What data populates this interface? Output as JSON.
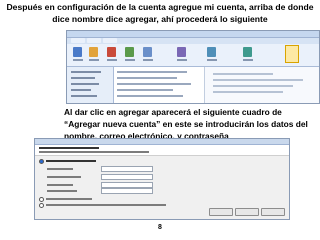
{
  "slide": {
    "top_caption": "Después en configuración de la cuenta agregue mi cuenta, arriba de donde dice nombre dice agregar, ahí procederá lo siguiente",
    "mid_caption": "Al dar clic en agregar aparecerá el siguiente cuadro de “Agregar nueva cuenta” en este se introducirán los datos del nombre, correo electrónico, y contraseña",
    "page_number": "8"
  },
  "colors": {
    "ribbon": "#eaf1fb",
    "highlight": "#fde9a4",
    "radio_selected": "#2a6ad2"
  }
}
